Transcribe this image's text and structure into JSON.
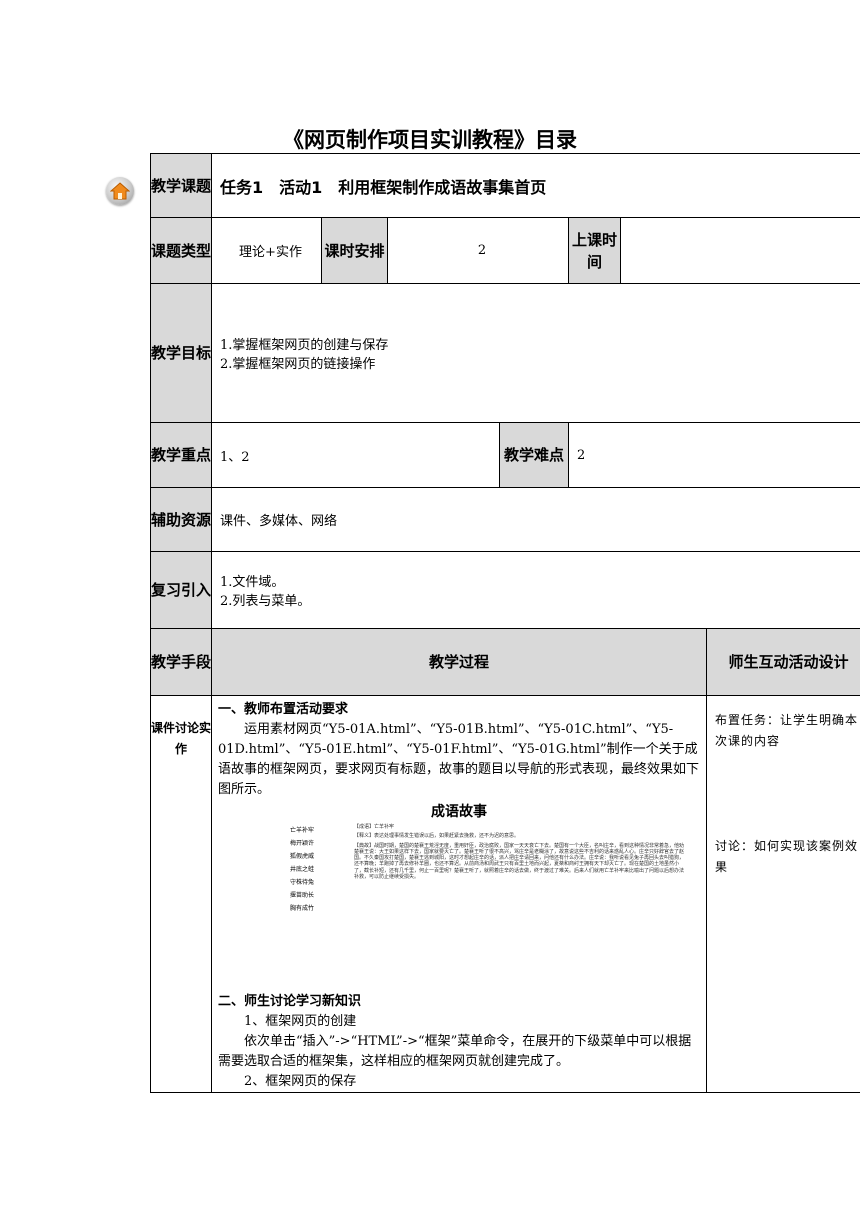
{
  "title": "《网页制作项目实训教程》目录",
  "rows": {
    "topic": {
      "label": "教学课题",
      "value": "任务1　活动1　利用框架制作成语故事集首页"
    },
    "type": {
      "label": "课题类型",
      "value": "理论+实作",
      "hours_label": "课时安排",
      "hours": "2",
      "time_label": "上课时间",
      "time": ""
    },
    "goal": {
      "label": "教学目标",
      "items": [
        "1.掌握框架网页的创建与保存",
        "2.掌握框架网页的链接操作"
      ]
    },
    "focus": {
      "label": "教学重点",
      "value": "1、2",
      "difficulty_label": "教学难点",
      "difficulty": "2"
    },
    "resources": {
      "label": "辅助资源",
      "value": "课件、多媒体、网络"
    },
    "review": {
      "label": "复习引入",
      "items": [
        "1.文件域。",
        "2.列表与菜单。"
      ]
    },
    "means": {
      "label": "教学手段",
      "process_label": "教学过程",
      "interaction_label": "师生互动活动设计"
    }
  },
  "process": {
    "left": "课件讨论实作",
    "sec1_title": "一、教师布置活动要求",
    "sec1_text": "运用素材网页“Y5-01A.html”、“Y5-01B.html”、“Y5-01C.html”、“Y5-01D.html”、“Y5-01E.html”、“Y5-01F.html”、“Y5-01G.html”制作一个关于成语故事的框架网页，要求网页有标题，故事的题目以导航的形式表现，最终效果如下图所示。",
    "screenshot": {
      "title": "成语故事",
      "nav": [
        "亡羊补牢",
        "梅开颖许",
        "狐假虎威",
        "井底之蛙",
        "守株待兔",
        "揠苗助长",
        "胸有成竹"
      ],
      "story_title": "【成语】亡羊补牢",
      "story_meaning": "【释义】表达处理事情发生错误以后，如果赶紧去挽救，还不为迟的意思。",
      "story_text": "【典故】战国时期，楚国的楚襄王荒淫无度，重用奸臣，政治腐败，国家一天天衰亡下去。楚国有一个大臣，名叫庄辛，看到这种情况非常着急，他劝楚襄王说：大王如果这样下去，国家就要灭亡了。楚襄王听了很不高兴，骂庄辛是老糊涂了，故意说这些不吉利的话来惑乱人心。庄辛只好辞官去了赵国。不久秦国攻打楚国，楚襄王逃到城阳，这时才想起庄辛的话，派人把庄辛请回来，问他还有什么办法。庄辛说：我听说看见兔子再回头去叫猎狗，还不算晚；羊跑掉了再去修补羊圈，也还不算迟。从前商汤和周武王只有百里土地而兴起，夏桀和商纣王拥有天下却灭亡了。现在楚国的土地虽然小了，截长补短，还有几千里，何止一百里呢？楚襄王听了，就照着庄辛的话去做，终于渡过了难关。后来人们就用亡羊补牢来比喻出了问题以后想办法补救，可以防止继续受损失。"
    },
    "sec2_title": "二、师生讨论学习新知识",
    "sec2_lines": [
      "1、框架网页的创建",
      "依次单击“插入”->“HTML”->“框架”菜单命令，在展开的下级菜单中可以根据需要选取合适的框架集，这样相应的框架网页就创建完成了。",
      "2、框架网页的保存"
    ],
    "right_top": "布置任务：让学生明确本次课的内容",
    "right_bottom": "讨论：如何实现该案例效果"
  },
  "colors": {
    "header_bg": "#d9d9d9",
    "border": "#000000"
  },
  "icons": {
    "home": "home-icon"
  }
}
